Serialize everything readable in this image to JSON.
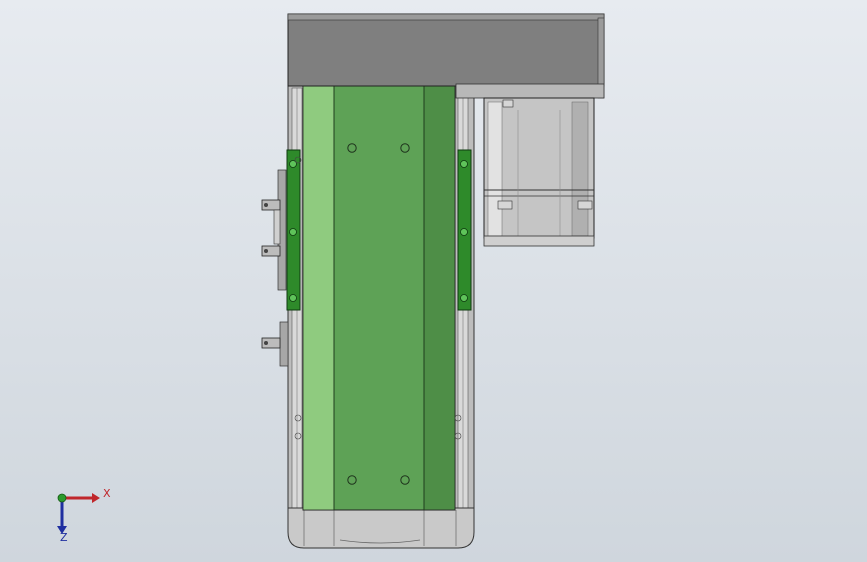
{
  "viewport": {
    "background": [
      "#e7ebf0",
      "#cfd6dd"
    ]
  },
  "model": {
    "housing_color": "#7f7f7f",
    "frame_color": "#bcbcbc",
    "belt_color": "#5ea256",
    "belt_light_color": "#8fcb7f",
    "bracket_color": "#2e8a2a",
    "motor_color": "#c5c5c5"
  },
  "triad": {
    "x_label": "X",
    "y_label": "Z",
    "x_color": "#c0262b",
    "y_color": "#1f2fa0",
    "origin_color": "#2c9a2c"
  }
}
